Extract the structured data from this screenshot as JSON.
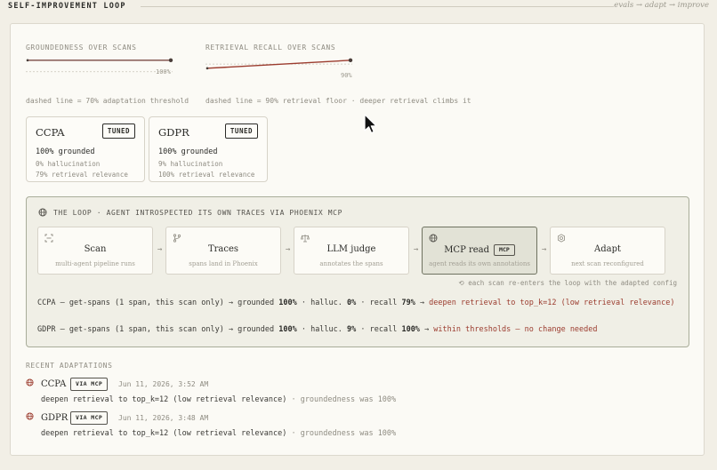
{
  "header": {
    "title": "SELF-IMPROVEMENT LOOP",
    "tagline": "evals → adapt → improve"
  },
  "metrics": [
    {
      "label": "GROUNDEDNESS OVER SCANS",
      "value_label": "100%",
      "series": [
        100,
        100
      ],
      "threshold": 70,
      "note": "dashed line = 70% adaptation threshold"
    },
    {
      "label": "RETRIEVAL RECALL OVER SCANS",
      "value_label": "90%",
      "series": [
        79,
        100
      ],
      "threshold": 90,
      "note": "dashed line = 90% retrieval floor · deeper retrieval climbs it"
    }
  ],
  "regulations": [
    {
      "name": "CCPA",
      "badge": "TUNED",
      "grounded": "100% grounded",
      "hallucination": "0% hallucination",
      "relevance": "79% retrieval relevance"
    },
    {
      "name": "GDPR",
      "badge": "TUNED",
      "grounded": "100% grounded",
      "hallucination": "9% hallucination",
      "relevance": "100% retrieval relevance"
    }
  ],
  "loop": {
    "heading": "THE LOOP · AGENT INTROSPECTED ITS OWN TRACES VIA PHOENIX MCP",
    "steps": [
      {
        "name": "Scan",
        "desc": "multi-agent pipeline runs",
        "icon": "scan-icon"
      },
      {
        "name": "Traces",
        "desc": "spans land in Phoenix",
        "icon": "branch-icon"
      },
      {
        "name": "LLM judge",
        "desc": "annotates the spans",
        "icon": "scales-icon"
      },
      {
        "name": "MCP read",
        "badge": "MCP",
        "desc": "agent reads its own annotations",
        "icon": "globe-icon"
      },
      {
        "name": "Adapt",
        "desc": "next scan reconfigured",
        "icon": "gear-icon"
      }
    ],
    "reenter_note": "each scan re-enters the loop with the adapted config",
    "traces": [
      {
        "prefix": "CCPA — get-spans (1 span, this scan only) → grounded ",
        "grounded": "100%",
        "mid1": " · halluc. ",
        "halluc": "0%",
        "mid2": " · recall ",
        "recall": "79%",
        "arrow": " → ",
        "action": "deepen retrieval to top_k=12 (low retrieval relevance)"
      },
      {
        "prefix": "GDPR — get-spans (1 span, this scan only) → grounded ",
        "grounded": "100%",
        "mid1": " · halluc. ",
        "halluc": "9%",
        "mid2": " · recall ",
        "recall": "100%",
        "arrow": " → ",
        "action": "within thresholds — no change needed"
      }
    ]
  },
  "recent": {
    "label": "RECENT ADAPTATIONS",
    "items": [
      {
        "name": "CCPA",
        "badge": "VIA MCP",
        "time": "Jun 11, 2026, 3:52 AM",
        "action": "deepen retrieval to top_k=12 (low retrieval relevance)",
        "detail": " · groundedness was 100%"
      },
      {
        "name": "GDPR",
        "badge": "VIA MCP",
        "time": "Jun 11, 2026, 3:48 AM",
        "action": "deepen retrieval to top_k=12 (low retrieval relevance)",
        "detail": " · groundedness was 100%"
      }
    ]
  },
  "colors": {
    "accent_red": "#9b3b2e",
    "loop_border": "#a9ad9a",
    "active_step": "#e2e2d6"
  }
}
